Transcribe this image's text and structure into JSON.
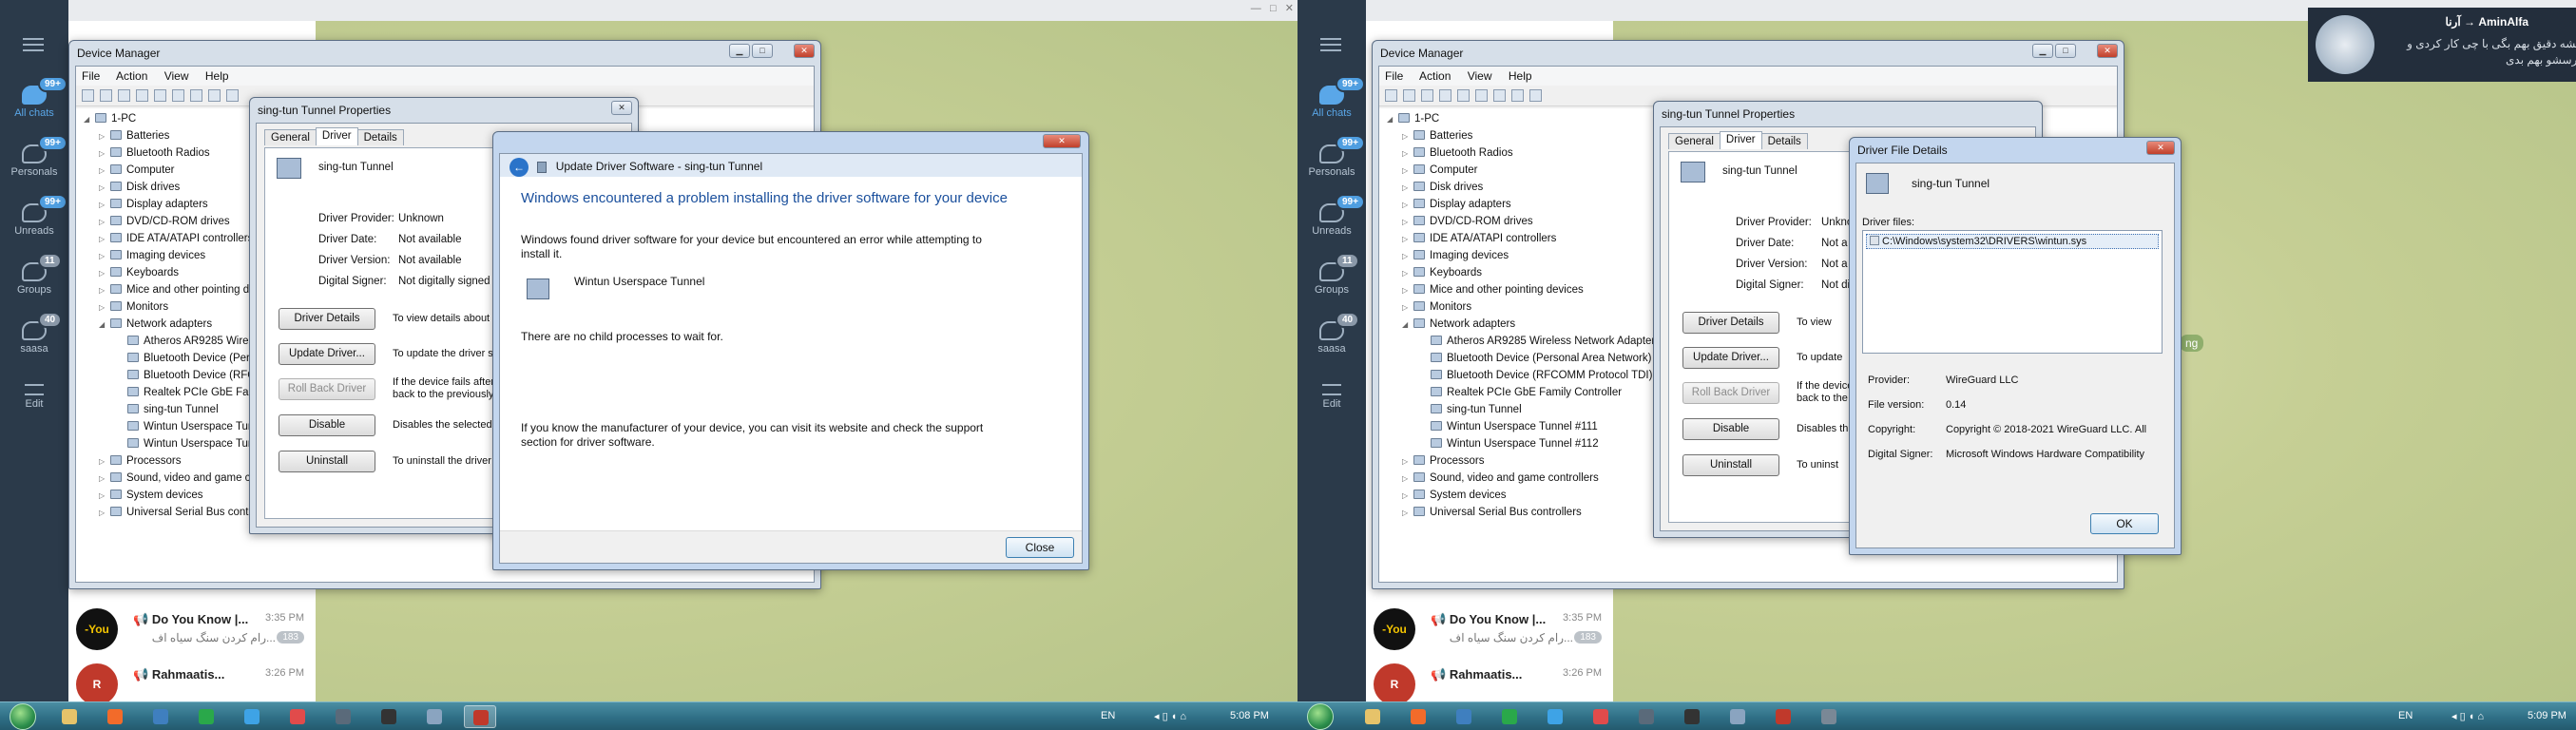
{
  "telegram": {
    "rail": {
      "items": [
        {
          "label": "All chats",
          "badge": "99+",
          "active": true
        },
        {
          "label": "Personals",
          "badge": "99+"
        },
        {
          "label": "Unreads",
          "badge": "99+"
        },
        {
          "label": "Groups",
          "badge": "11"
        },
        {
          "label": "saasa",
          "badge": "40"
        },
        {
          "label": "Edit"
        }
      ]
    },
    "chats": [
      {
        "title": "Do You Know |...",
        "time": "3:35 PM",
        "preview": "...رام کردن سنگ سیاه اف",
        "count": "183",
        "avatar": "-You"
      },
      {
        "title": "Rahmaatis...",
        "time": "3:26 PM",
        "avatar": "R"
      }
    ],
    "toast": {
      "title": "AminAlfa → آرنا",
      "body": "میشه دقیق بهم بگی با چی کار کردی و آدرسشو بهم بدی"
    },
    "partial_right_text": "ng"
  },
  "device_manager": {
    "title": "Device Manager",
    "menu": [
      "File",
      "Action",
      "View",
      "Help"
    ],
    "tree": [
      {
        "label": "1-PC",
        "level": 0,
        "exp": "◢"
      },
      {
        "label": "Batteries",
        "level": 1,
        "exp": "▷"
      },
      {
        "label": "Bluetooth Radios",
        "level": 1,
        "exp": "▷"
      },
      {
        "label": "Computer",
        "level": 1,
        "exp": "▷"
      },
      {
        "label": "Disk drives",
        "level": 1,
        "exp": "▷"
      },
      {
        "label": "Display adapters",
        "level": 1,
        "exp": "▷"
      },
      {
        "label": "DVD/CD-ROM drives",
        "level": 1,
        "exp": "▷"
      },
      {
        "label": "IDE ATA/ATAPI controllers",
        "level": 1,
        "exp": "▷"
      },
      {
        "label": "Imaging devices",
        "level": 1,
        "exp": "▷"
      },
      {
        "label": "Keyboards",
        "level": 1,
        "exp": "▷"
      },
      {
        "label": "Mice and other pointing devices",
        "level": 1,
        "exp": "▷"
      },
      {
        "label": "Monitors",
        "level": 1,
        "exp": "▷"
      },
      {
        "label": "Network adapters",
        "level": 1,
        "exp": "◢"
      },
      {
        "label": "Atheros AR9285 Wireless Network Adapter",
        "level": 2
      },
      {
        "label": "Bluetooth Device (Personal Area Network)",
        "level": 2
      },
      {
        "label": "Bluetooth Device (RFCOMM Protocol TDI)",
        "level": 2
      },
      {
        "label": "Realtek PCIe GbE Family Controller",
        "level": 2
      },
      {
        "label": "sing-tun Tunnel",
        "level": 2
      },
      {
        "label": "Wintun Userspace Tunnel #111",
        "level": 2
      },
      {
        "label": "Wintun Userspace Tunnel #112",
        "level": 2
      },
      {
        "label": "Processors",
        "level": 1,
        "exp": "▷"
      },
      {
        "label": "Sound, video and game controllers",
        "level": 1,
        "exp": "▷"
      },
      {
        "label": "System devices",
        "level": 1,
        "exp": "▷"
      },
      {
        "label": "Universal Serial Bus controllers",
        "level": 1,
        "exp": "▷"
      }
    ]
  },
  "properties": {
    "title": "sing-tun Tunnel Properties",
    "tabs": [
      "General",
      "Driver",
      "Details"
    ],
    "device_name": "sing-tun Tunnel",
    "fields_left": [
      {
        "label": "Driver Provider:",
        "value": "Unknown"
      },
      {
        "label": "Driver Date:",
        "value": "Not available"
      },
      {
        "label": "Driver Version:",
        "value": "Not available"
      },
      {
        "label": "Digital Signer:",
        "value": "Not digitally signed"
      }
    ],
    "fields_right": [
      {
        "label": "Driver Provider:",
        "value": "Unkno"
      },
      {
        "label": "Driver Date:",
        "value": "Not a"
      },
      {
        "label": "Driver Version:",
        "value": "Not a"
      },
      {
        "label": "Digital Signer:",
        "value": "Not digi"
      }
    ],
    "buttons": [
      "Driver Details",
      "Update Driver...",
      "Roll Back Driver",
      "Disable",
      "Uninstall"
    ],
    "descs_left": [
      "To view details about",
      "To update the driver s",
      "If the device fails after\nback to the previously",
      "Disables the selected",
      "To uninstall the driver"
    ],
    "descs_right": [
      "To view",
      "To update",
      "If the device\nback to the",
      "Disables th",
      "To uninst"
    ]
  },
  "update_dialog": {
    "title": "Update Driver Software - sing-tun Tunnel",
    "headline": "Windows encountered a problem installing the driver software for your device",
    "message": "Windows found driver software for your device but encountered an error while attempting to install it.",
    "device": "Wintun Userspace Tunnel",
    "error": "There are no child processes to wait for.",
    "hint": "If you know the manufacturer of your device, you can visit its website and check the support section for driver software.",
    "close_label": "Close"
  },
  "file_details": {
    "title": "Driver File Details",
    "device_name": "sing-tun Tunnel",
    "files_label": "Driver files:",
    "files": [
      "C:\\Windows\\system32\\DRIVERS\\wintun.sys"
    ],
    "fields": [
      {
        "label": "Provider:",
        "value": "WireGuard LLC"
      },
      {
        "label": "File version:",
        "value": "0.14"
      },
      {
        "label": "Copyright:",
        "value": "Copyright © 2018-2021 WireGuard LLC. All"
      },
      {
        "label": "Digital Signer:",
        "value": "Microsoft Windows Hardware Compatibility"
      }
    ],
    "ok_label": "OK"
  },
  "taskbar": {
    "left": {
      "lang": "EN",
      "time": "5:08 PM"
    },
    "right": {
      "lang": "EN",
      "time": "5:09 PM"
    }
  },
  "colors": {
    "rail_bg": "#2b3a4a",
    "accent": "#5aa7e8",
    "headline_blue": "#1a4f9c",
    "taskbar": "#2f6f86"
  }
}
